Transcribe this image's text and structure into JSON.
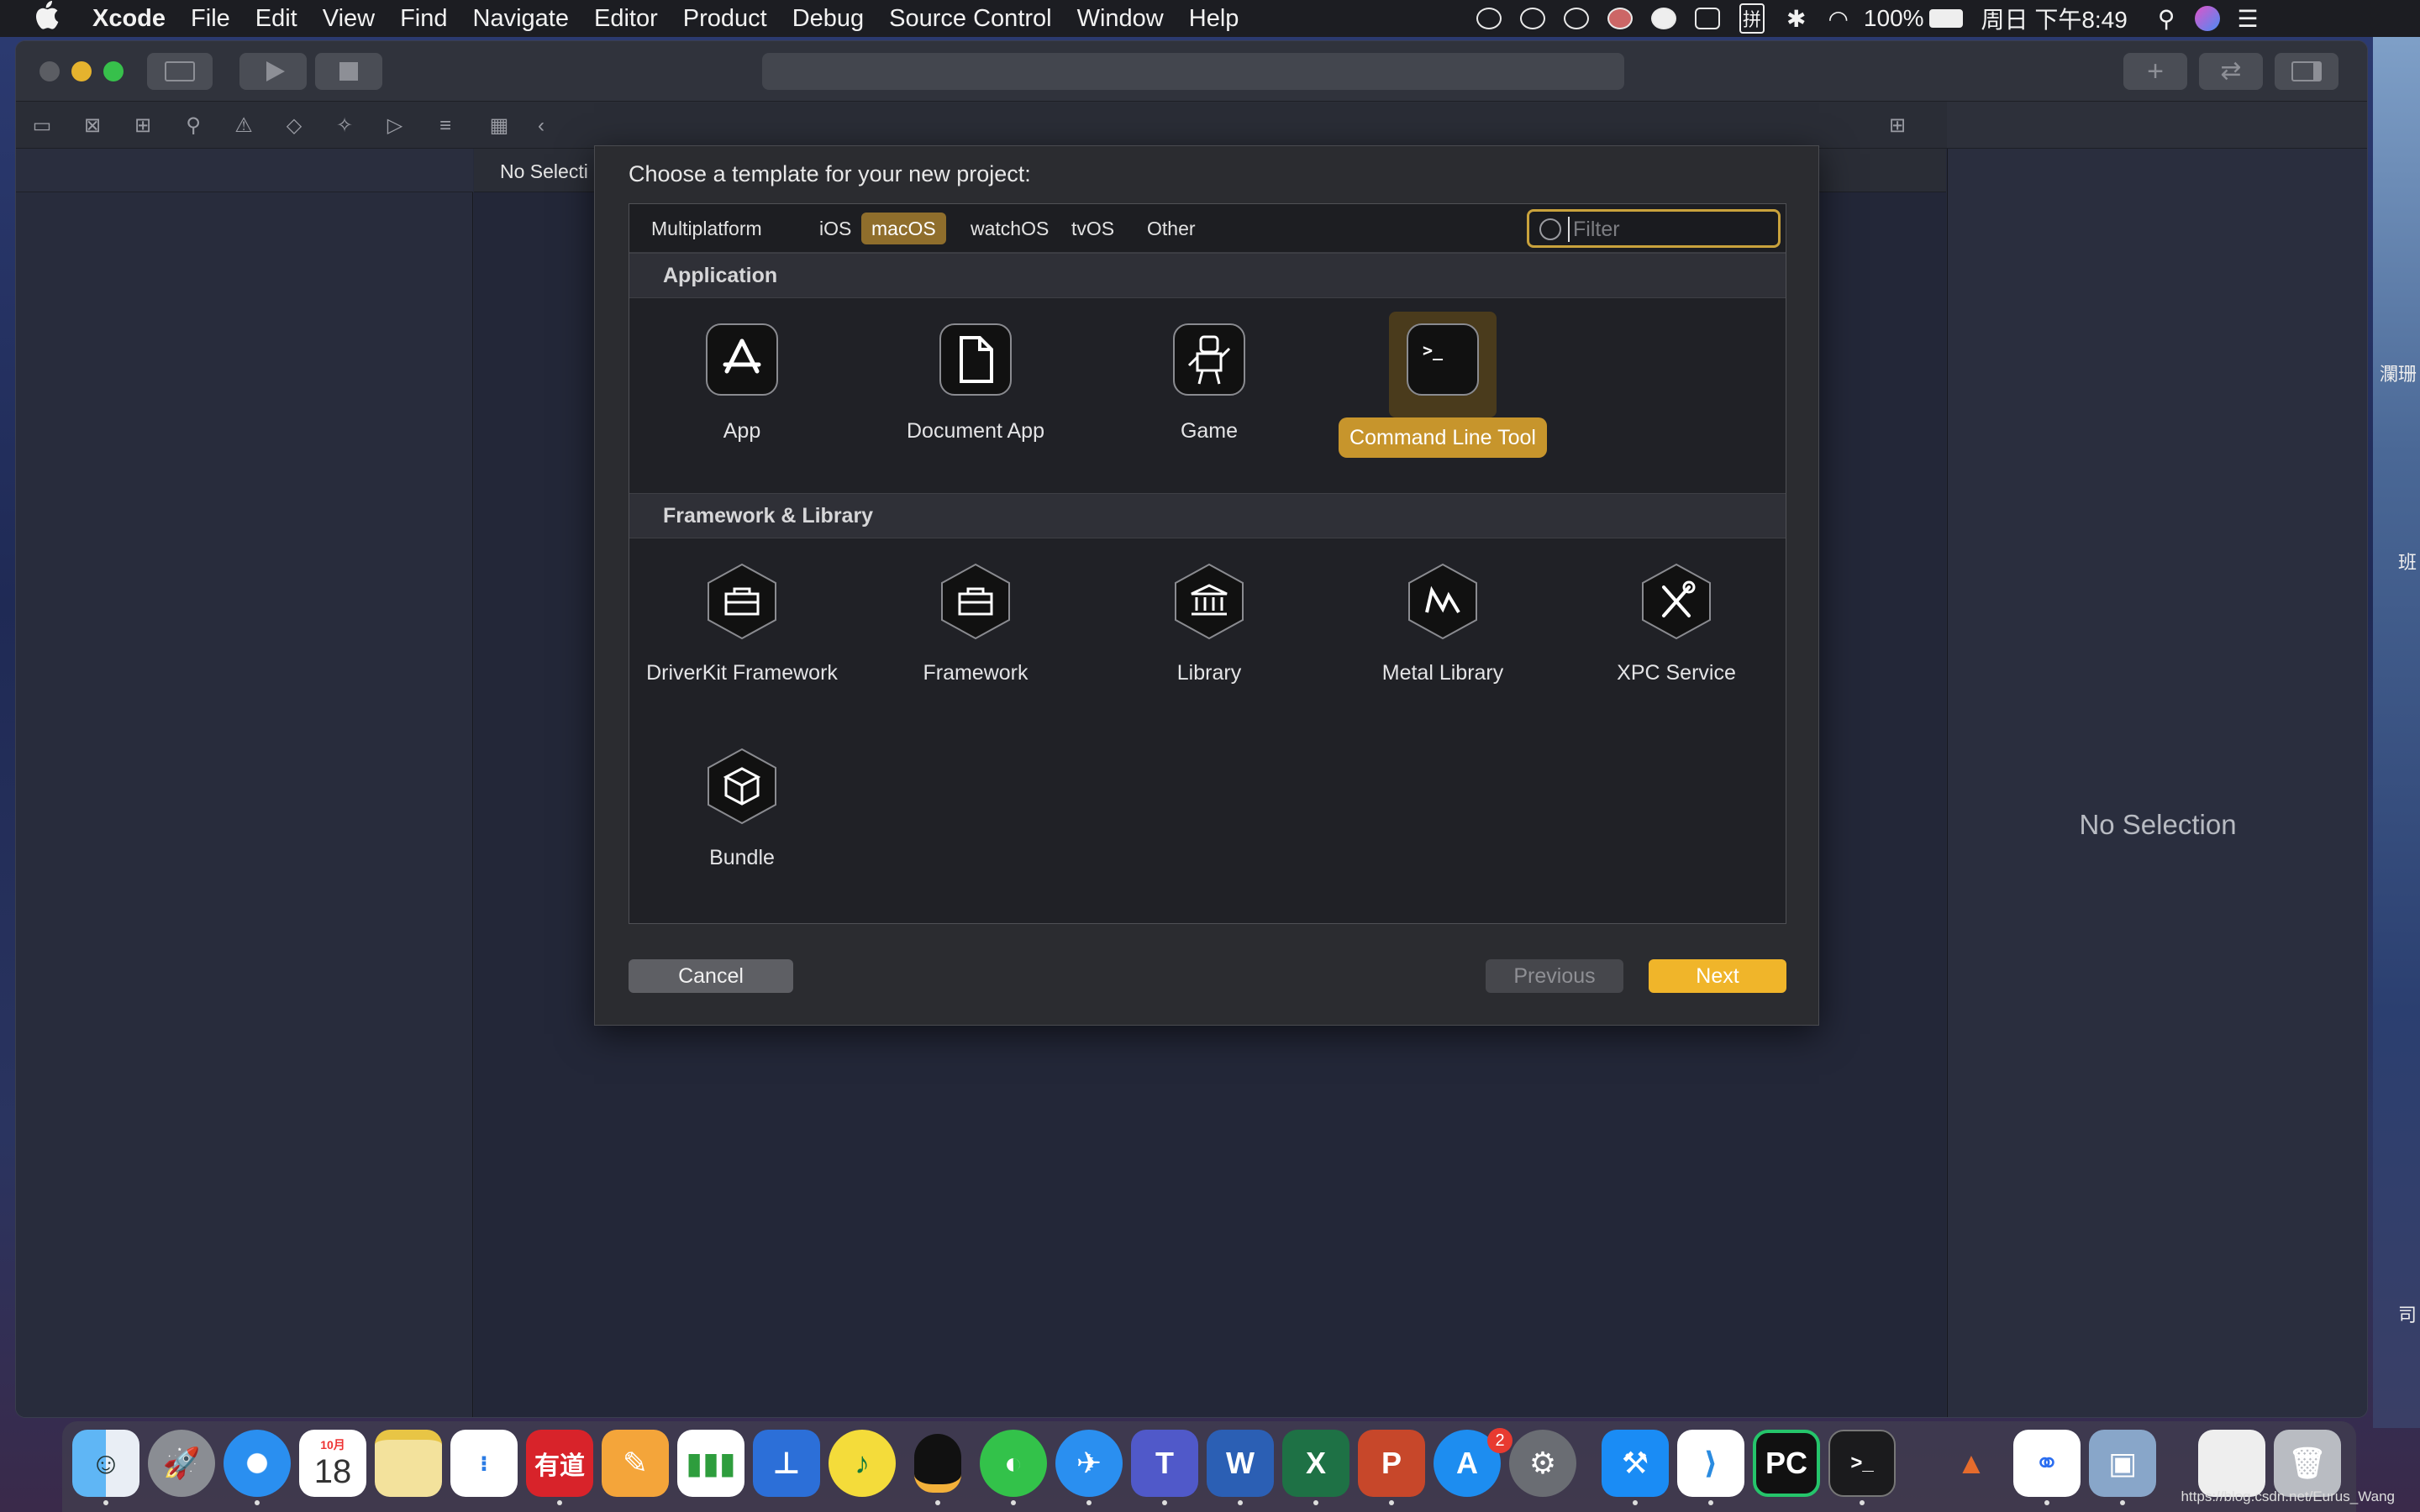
{
  "menubar": {
    "app_name": "Xcode",
    "items": [
      "File",
      "Edit",
      "View",
      "Find",
      "Navigate",
      "Editor",
      "Product",
      "Debug",
      "Source Control",
      "Window",
      "Help"
    ],
    "battery": "100%",
    "clock": "周日 下午8:49",
    "input_method": "拼"
  },
  "editor": {
    "breadcrumb": "No Selecti",
    "inspector_empty": "No Selection"
  },
  "sheet": {
    "title": "Choose a template for your new project:",
    "tabs": [
      "Multiplatform",
      "iOS",
      "macOS",
      "watchOS",
      "tvOS",
      "Other"
    ],
    "selected_tab": "macOS",
    "filter_placeholder": "Filter",
    "sections": [
      {
        "title": "Application",
        "templates": [
          "App",
          "Document App",
          "Game",
          "Command Line Tool"
        ]
      },
      {
        "title": "Framework & Library",
        "templates": [
          "DriverKit Framework",
          "Framework",
          "Library",
          "Metal Library",
          "XPC Service",
          "Bundle"
        ]
      }
    ],
    "selected_template": "Command Line Tool",
    "buttons": {
      "cancel": "Cancel",
      "previous": "Previous",
      "next": "Next"
    }
  },
  "dock": {
    "calendar_month": "10月",
    "calendar_day": "18",
    "youdao": "有道",
    "appstore_badge": "2",
    "pycharm": "PC"
  },
  "desktop_side_text": [
    "瀾珊",
    "班",
    "司"
  ],
  "watermark": "https://blog.csdn.net/Eurus_Wang",
  "colors": {
    "accent": "#c7952c",
    "selection_bg": "#8f6e2c",
    "next_button": "#f0b52a"
  }
}
